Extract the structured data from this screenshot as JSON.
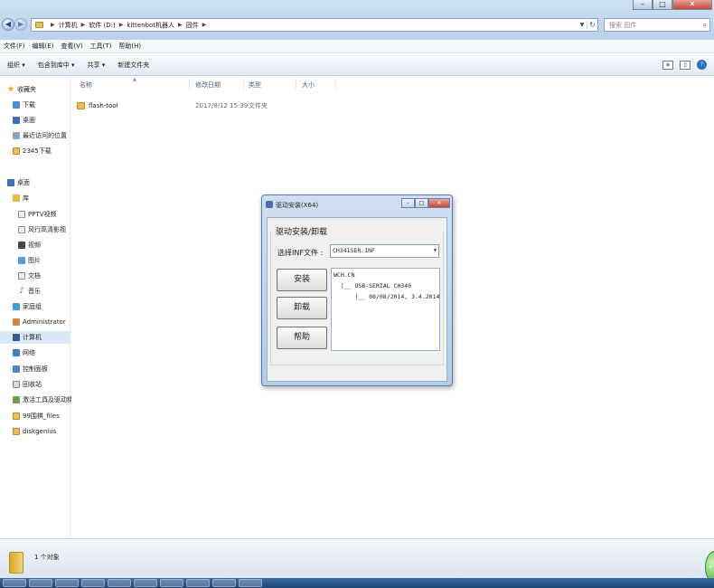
{
  "window": {
    "breadcrumbs": [
      "计算机",
      "软件 (D:)",
      "kittenbot机器人",
      "固件"
    ],
    "search_placeholder": "搜索 固件",
    "controls": {
      "minimize": "–",
      "maximize": "□",
      "close": "✕"
    }
  },
  "menu": [
    "文件(F)",
    "编辑(E)",
    "查看(V)",
    "工具(T)",
    "帮助(H)"
  ],
  "commands": [
    "组织 ▾",
    "包含到库中 ▾",
    "共享 ▾",
    "新建文件夹"
  ],
  "nav": {
    "favorites": {
      "label": "收藏夹",
      "items": [
        "下载",
        "桌面",
        "最近访问的位置",
        "2345下载"
      ]
    },
    "desktop": "桌面",
    "library": {
      "label": "库",
      "items": [
        "PPTV视频",
        "风行高清影视",
        "视频",
        "图片",
        "文档",
        "音乐"
      ]
    },
    "others": [
      "家庭组",
      "Administrator",
      "计算机",
      "网络",
      "控制面板",
      "回收站",
      "激活工具及驱动精灵",
      "99围棋_files",
      "diskgenius"
    ],
    "selected": "计算机"
  },
  "columns": [
    "名称",
    "修改日期",
    "类型",
    "大小"
  ],
  "files": [
    {
      "name": "flash-tool",
      "date": "2017/8/12 15:39",
      "type": "文件夹",
      "size": ""
    }
  ],
  "status": {
    "count": "1 个对象"
  },
  "dialog": {
    "title": "驱动安装(X64)",
    "group_title": "驱动安装/卸载",
    "inf_label": "选择INF文件 :",
    "inf_value": "CH341SER.INF",
    "buttons": {
      "install": "安装",
      "uninstall": "卸载",
      "help": "帮助"
    },
    "tree": [
      "WCH.CN",
      "  |__ USB-SERIAL CH340",
      "      |__ 08/08/2014, 3.4.2014"
    ]
  }
}
